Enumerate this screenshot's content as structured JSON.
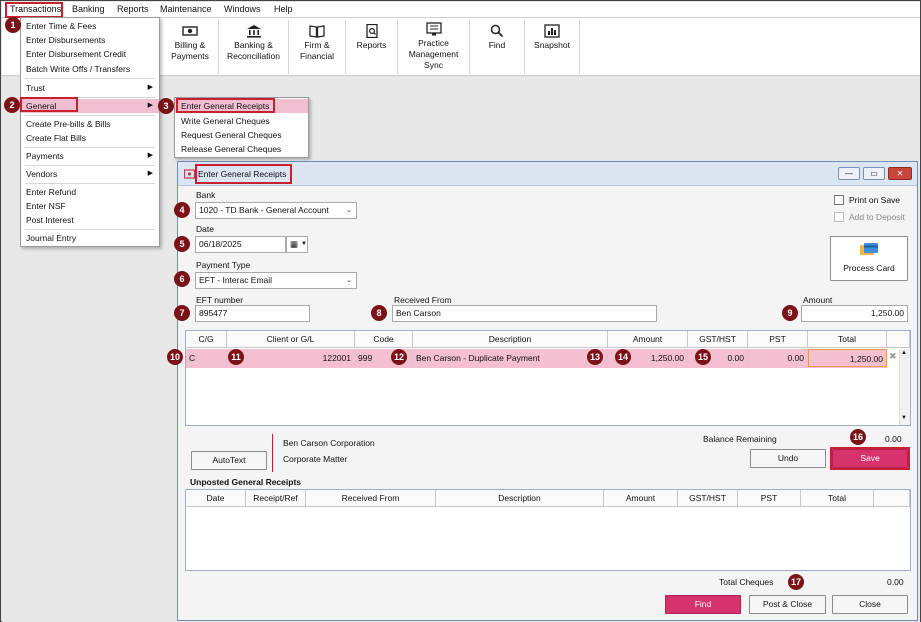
{
  "menubar": {
    "items": [
      "Transactions",
      "Banking",
      "Reports",
      "Maintenance",
      "Windows",
      "Help"
    ]
  },
  "toolbar": {
    "billing": "Billing & Payments",
    "banking": "Banking & Reconciliation",
    "firm": "Firm & Financial",
    "reports": "Reports",
    "pms": "Practice Management Sync",
    "find": "Find",
    "snapshot": "Snapshot"
  },
  "transactions_menu": {
    "items": [
      "Enter Time & Fees",
      "Enter Disbursements",
      "Enter Disbursement Credit",
      "Batch Write Offs / Transfers",
      "Trust",
      "General",
      "Create Pre-bills & Bills",
      "Create Flat Bills",
      "Payments",
      "Vendors",
      "Enter Refund",
      "Enter NSF",
      "Post Interest",
      "Journal Entry"
    ]
  },
  "general_submenu": {
    "items": [
      "Enter General Receipts",
      "Write General Cheques",
      "Request General Cheques",
      "Release General Cheques"
    ]
  },
  "badges": [
    "1",
    "2",
    "3",
    "4",
    "5",
    "6",
    "7",
    "8",
    "9",
    "10",
    "11",
    "12",
    "13",
    "14",
    "15",
    "16",
    "17"
  ],
  "window": {
    "title": "Enter General Receipts",
    "bank_label": "Bank",
    "bank_value": "1020 - TD Bank - General Account",
    "date_label": "Date",
    "date_value": "06/18/2025",
    "payment_type_label": "Payment Type",
    "payment_type_value": "EFT - Interac Email",
    "eft_label": "EFT number",
    "eft_value": "895477",
    "received_from_label": "Received From",
    "received_from_value": "Ben Carson",
    "amount_label": "Amount",
    "amount_value": "1,250.00",
    "print_on_save": "Print on Save",
    "add_to_deposit": "Add to Deposit",
    "process_card": "Process Card",
    "grid_headers": [
      "C/G",
      "Client or G/L",
      "Code",
      "Description",
      "Amount",
      "GST/HST",
      "PST",
      "Total"
    ],
    "row": {
      "cg": "C",
      "client": "122001",
      "code": "999",
      "description": "Ben Carson - Duplicate Payment",
      "amount": "1,250.00",
      "gst": "0.00",
      "pst": "0.00",
      "total": "1,250.00"
    },
    "client_name": "Ben Carson Corporation",
    "matter_name": "Corporate Matter",
    "autotext": "AutoText",
    "balance_remaining_label": "Balance Remaining",
    "balance_remaining_value": "0.00",
    "undo": "Undo",
    "save": "Save",
    "unposted_title": "Unposted General Receipts",
    "unposted_headers": [
      "Date",
      "Receipt/Ref",
      "Received From",
      "Description",
      "Amount",
      "GST/HST",
      "PST",
      "Total"
    ],
    "total_cheques_label": "Total Cheques",
    "total_cheques_value": "0.00",
    "find": "Find",
    "post_close": "Post & Close",
    "close": "Close"
  }
}
